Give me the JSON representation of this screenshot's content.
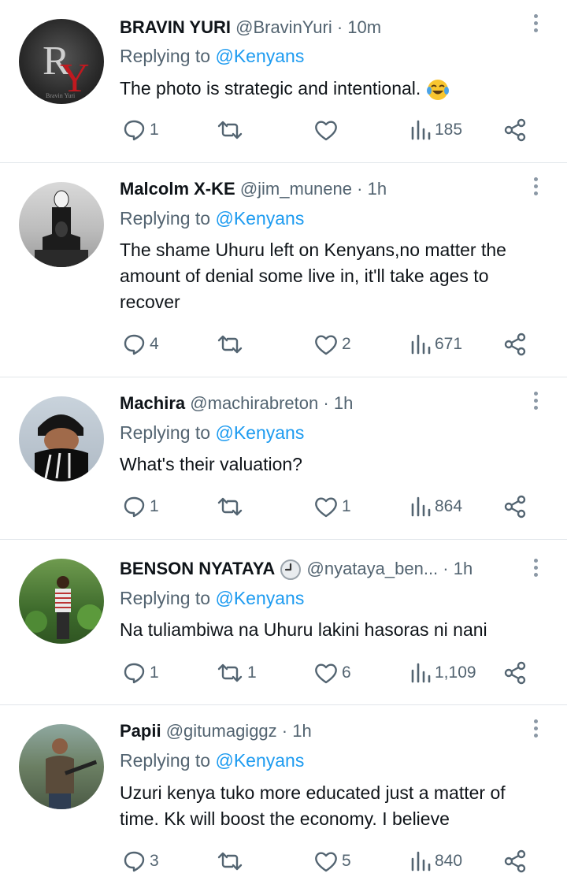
{
  "reply_prefix": "Replying to",
  "tweets": [
    {
      "name": "BRAVIN YURI",
      "handle": "@BravinYuri",
      "dot": "·",
      "time": "10m",
      "reply_to": "@Kenyans",
      "text": "The photo is strategic and intentional.",
      "emoji": "face-with-tears-of-joy",
      "replies": "1",
      "retweets": "",
      "likes": "",
      "views": "185",
      "avatar": "ry-monogram-logo"
    },
    {
      "name": "Malcolm X-KE",
      "handle": "@jim_munene",
      "dot": "·",
      "time": "1h",
      "reply_to": "@Kenyans",
      "text": "The shame Uhuru left on Kenyans,no matter the amount of denial some live in, it'll take ages to recover",
      "replies": "4",
      "retweets": "",
      "likes": "2",
      "views": "671",
      "avatar": "masked-figures-photo"
    },
    {
      "name": "Machira",
      "handle": "@machirabreton",
      "dot": "·",
      "time": "1h",
      "reply_to": "@Kenyans",
      "text": "What's their valuation?",
      "replies": "1",
      "retweets": "",
      "likes": "1",
      "views": "864",
      "avatar": "man-in-beanie-photo"
    },
    {
      "name": "BENSON NYATAYA",
      "handle": "@nyataya_ben...",
      "dot": "·",
      "time": "1h",
      "badge": "clock-emoji",
      "reply_to": "@Kenyans",
      "text": "Na tuliambiwa na Uhuru lakini hasoras ni nani",
      "replies": "1",
      "retweets": "1",
      "likes": "6",
      "views": "1,109",
      "avatar": "man-in-garden-photo"
    },
    {
      "name": "Papii",
      "handle": "@gitumagiggz",
      "dot": "·",
      "time": "1h",
      "reply_to": "@Kenyans",
      "text": "Uzuri kenya tuko more educated just a matter of time. Kk will boost the economy. I believe",
      "replies": "3",
      "retweets": "",
      "likes": "5",
      "views": "840",
      "avatar": "game-character-photo"
    }
  ],
  "colors": {
    "name": "#0f1419",
    "secondary": "#536471",
    "mention": "#1d9bf0",
    "divider": "#e1e6ea"
  }
}
